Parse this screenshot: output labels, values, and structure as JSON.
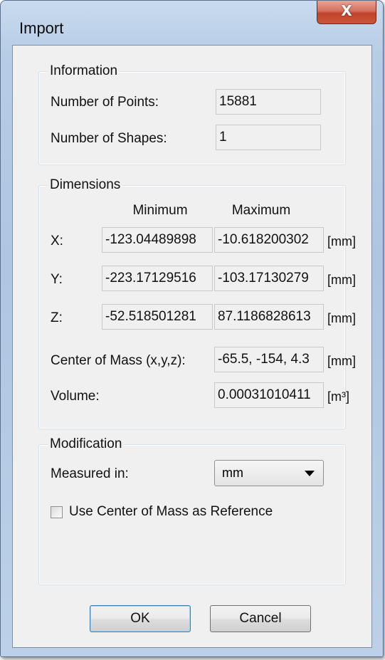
{
  "window": {
    "title": "Import",
    "close_glyph": "X"
  },
  "information": {
    "legend": "Information",
    "points_label": "Number of Points:",
    "points_value": "15881",
    "shapes_label": "Number of Shapes:",
    "shapes_value": "1"
  },
  "dimensions": {
    "legend": "Dimensions",
    "col_min": "Minimum",
    "col_max": "Maximum",
    "rows": [
      {
        "label": "X:",
        "min": "-123.04489898",
        "max": "-10.618200302",
        "unit": "[mm]"
      },
      {
        "label": "Y:",
        "min": "-223.17129516",
        "max": "-103.17130279",
        "unit": "[mm]"
      },
      {
        "label": "Z:",
        "min": "-52.518501281",
        "max": "87.1186828613",
        "unit": "[mm]"
      }
    ],
    "com_label": "Center of Mass (x,y,z):",
    "com_value": "-65.5, -154, 4.3",
    "com_unit": "[mm]",
    "volume_label": "Volume:",
    "volume_value": "0.00031010411",
    "volume_unit": "[m³]"
  },
  "modification": {
    "legend": "Modification",
    "measured_label": "Measured in:",
    "measured_value": "mm",
    "use_com_label": "Use Center of Mass as Reference",
    "use_com_checked": false
  },
  "buttons": {
    "ok": "OK",
    "cancel": "Cancel"
  }
}
